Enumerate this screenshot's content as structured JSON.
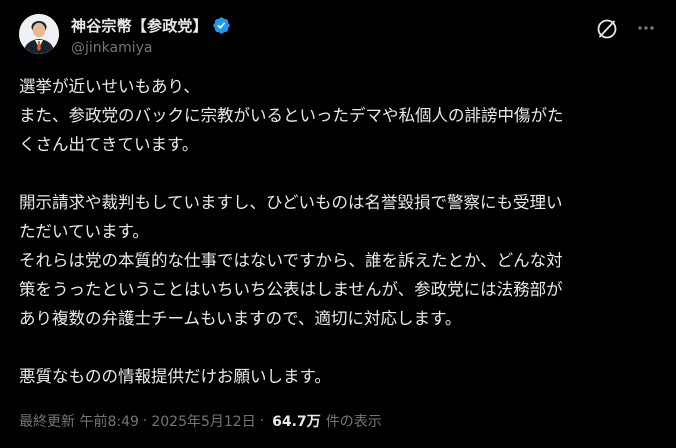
{
  "author": {
    "display_name": "神谷宗幣【参政党】",
    "handle": "@jinkamiya",
    "verified_color": "#1d9bf0",
    "avatar_icon": "avatar-photo"
  },
  "actions": {
    "grok_icon": "grok-icon",
    "more_icon": "more-icon"
  },
  "post": {
    "lines": [
      "選挙が近いせいもあり、",
      "また、参政党のバックに宗教がいるといったデマや私個人の誹謗中傷がた",
      "くさん出てきています。",
      "",
      "開示請求や裁判もしていますし、ひどいものは名誉毀損で警察にも受理い",
      "ただいています。",
      "それらは党の本質的な仕事ではないですから、誰を訴えたとか、どんな対",
      "策をうったということはいちいち公表はしませんが、参政党には法務部が",
      "あり複数の弁護士チームもいますので、適切に対応します。",
      "",
      "悪質なものの情報提供だけお願いします。"
    ]
  },
  "meta": {
    "prefix": "最終更新 午前8:49",
    "separator": "·",
    "date": "2025年5月12日",
    "views_count": "64.7万",
    "views_label": "件の表示"
  }
}
